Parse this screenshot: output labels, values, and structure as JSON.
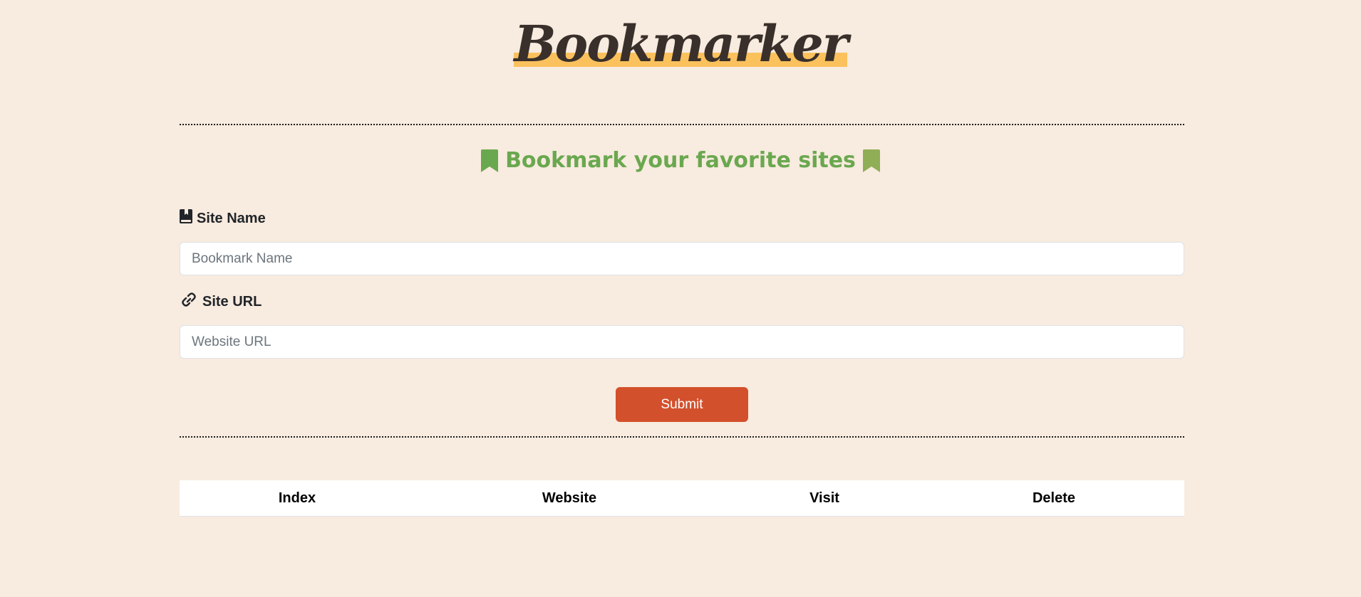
{
  "app": {
    "title": "Bookmarker",
    "tagline": "Bookmark your favorite sites"
  },
  "form": {
    "site_name_label": "Site Name",
    "site_name_placeholder": "Bookmark Name",
    "site_name_value": "",
    "site_url_label": "Site URL",
    "site_url_placeholder": "Website URL",
    "site_url_value": "",
    "submit_label": "Submit"
  },
  "table": {
    "columns": [
      "Index",
      "Website",
      "Visit",
      "Delete"
    ],
    "rows": []
  },
  "colors": {
    "background": "#f8ebdf",
    "title_highlight": "#fbc15d",
    "tagline": "#6aa84f",
    "submit_button": "#d3502c"
  },
  "icons": {
    "tagline_left": "bookmark-icon",
    "tagline_right": "bookmark-icon",
    "site_name": "book-bookmark-icon",
    "site_url": "link-icon"
  }
}
